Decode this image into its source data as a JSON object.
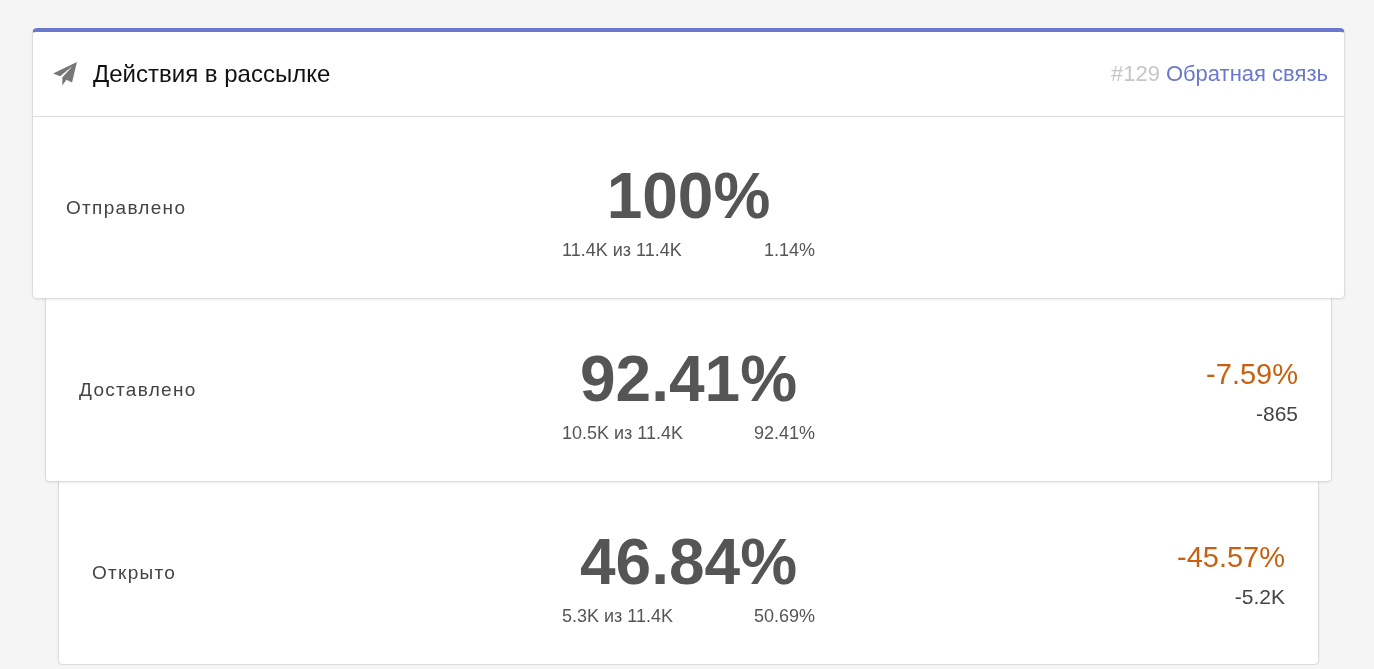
{
  "card": {
    "title": "Действия в рассылке",
    "number": "#129",
    "link": "Обратная связь"
  },
  "stages": [
    {
      "label": "Отправлено",
      "value": "100%",
      "count": "11.4K из 11.4K",
      "share": "1.14%"
    },
    {
      "label": "Доставлено",
      "value": "92.41%",
      "count": "10.5K из 11.4K",
      "share": "92.41%",
      "change": "-7.59%",
      "negative": true,
      "difference": "-865"
    },
    {
      "label": "Открыто",
      "value": "46.84%",
      "count": "5.3K из 11.4K",
      "share": "50.69%",
      "change": "-45.57%",
      "negative": true,
      "difference": "-5.2K"
    }
  ]
}
